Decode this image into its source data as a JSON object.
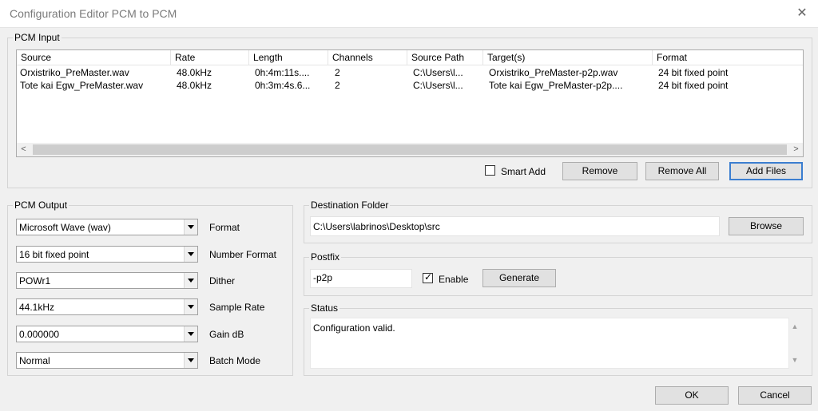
{
  "window": {
    "title": "Configuration Editor PCM to PCM",
    "close_glyph": "✕"
  },
  "pcm_input": {
    "legend": "PCM Input",
    "columns": [
      "Source",
      "Rate",
      "Length",
      "Channels",
      "Source Path",
      "Target(s)",
      "Format"
    ],
    "rows": [
      [
        "Orxistriko_PreMaster.wav",
        "48.0kHz",
        "0h:4m:11s....",
        "2",
        "C:\\Users\\l...",
        "Orxistriko_PreMaster-p2p.wav",
        "24 bit fixed point"
      ],
      [
        "Tote kai Egw_PreMaster.wav",
        "48.0kHz",
        "0h:3m:4s.6...",
        "2",
        "C:\\Users\\l...",
        "Tote kai Egw_PreMaster-p2p....",
        "24 bit fixed point"
      ]
    ],
    "smart_add_label": "Smart Add",
    "smart_add_checked": false,
    "remove_label": "Remove",
    "remove_all_label": "Remove All",
    "add_files_label": "Add Files",
    "scroll_left": "<",
    "scroll_right": ">"
  },
  "pcm_output": {
    "legend": "PCM Output",
    "fields": [
      {
        "value": "Microsoft Wave (wav)",
        "label": "Format"
      },
      {
        "value": "16 bit fixed point",
        "label": "Number Format"
      },
      {
        "value": "POWr1",
        "label": "Dither"
      },
      {
        "value": "44.1kHz",
        "label": "Sample Rate"
      },
      {
        "value": "0.000000",
        "label": "Gain dB"
      },
      {
        "value": "Normal",
        "label": "Batch Mode"
      }
    ]
  },
  "destination": {
    "legend": "Destination Folder",
    "path": "C:\\Users\\labrinos\\Desktop\\src",
    "browse_label": "Browse"
  },
  "postfix": {
    "legend": "Postfix",
    "value": "-p2p",
    "enable_label": "Enable",
    "enable_checked": true,
    "generate_label": "Generate"
  },
  "status": {
    "legend": "Status",
    "message": "Configuration valid."
  },
  "footer": {
    "ok_label": "OK",
    "cancel_label": "Cancel"
  }
}
